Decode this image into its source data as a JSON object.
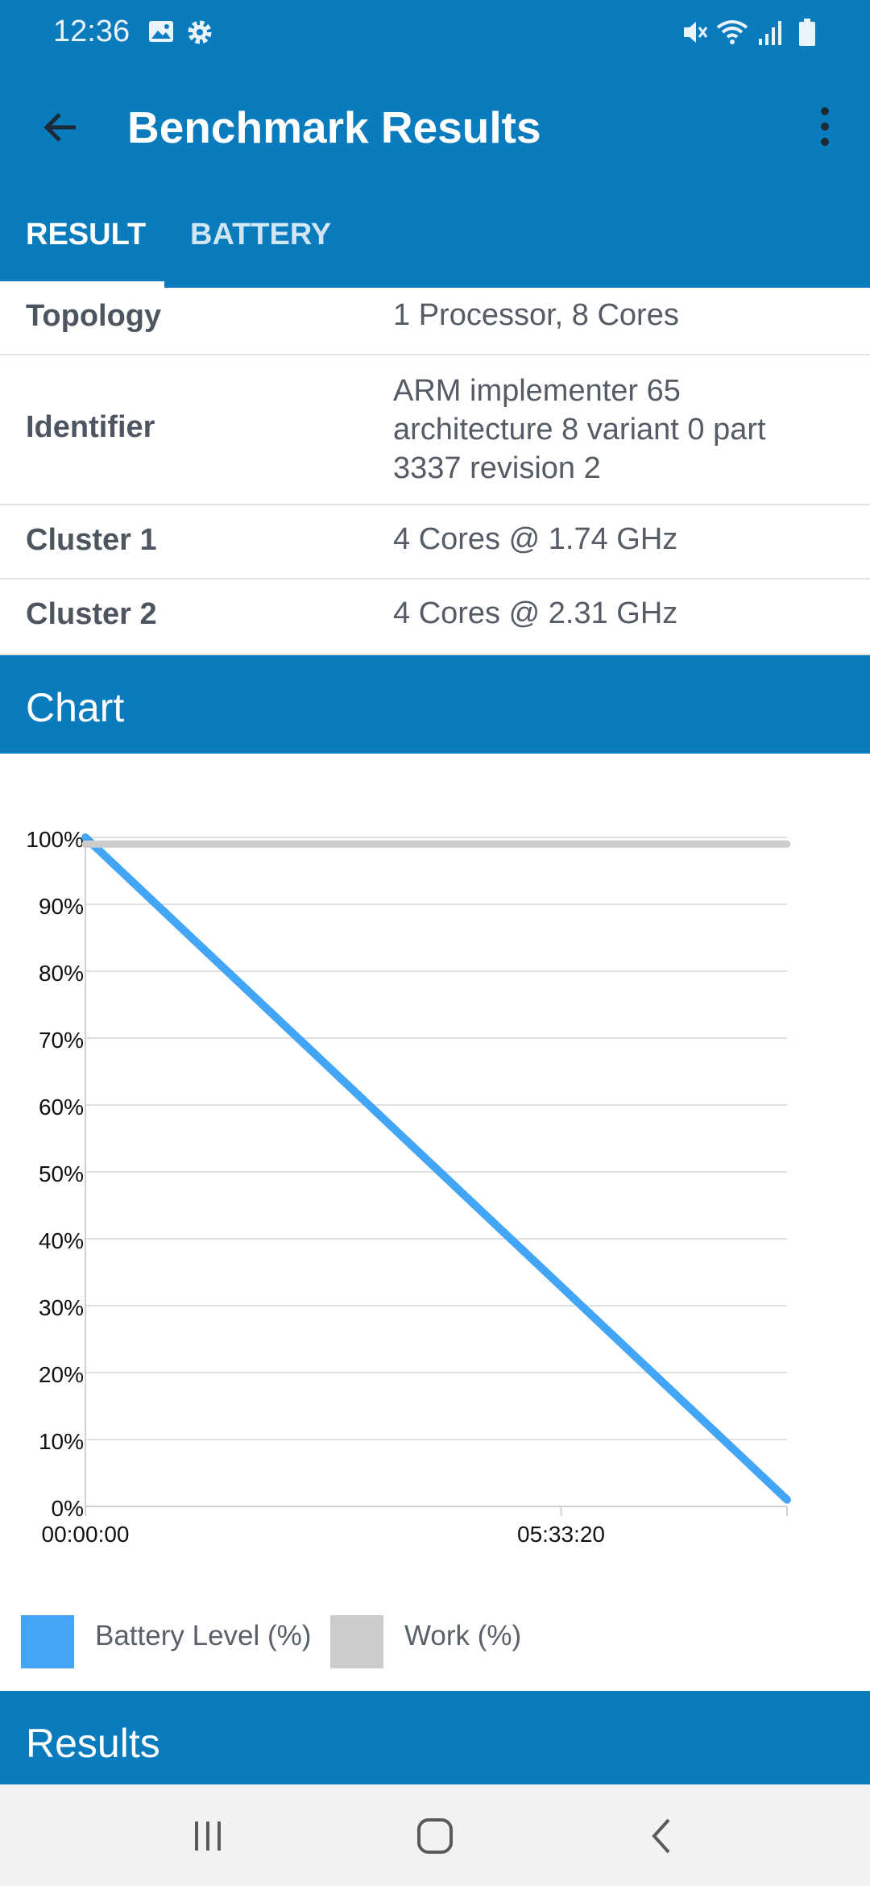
{
  "status_bar": {
    "time": "12:36",
    "icons": [
      "image-icon",
      "settings-gear-icon",
      "mute-icon",
      "wifi-icon",
      "signal-icon",
      "battery-icon"
    ]
  },
  "toolbar": {
    "title": "Benchmark Results",
    "back_icon": "arrow-back-icon",
    "more_icon": "more-vert-icon"
  },
  "tabs": [
    {
      "label": "RESULT",
      "active": true
    },
    {
      "label": "BATTERY",
      "active": false
    }
  ],
  "info_rows": [
    {
      "key": "Topology",
      "value": "1 Processor, 8 Cores"
    },
    {
      "key": "Identifier",
      "value_lines": [
        "ARM implementer 65",
        "architecture 8 variant 0 part",
        "3337 revision 2"
      ]
    },
    {
      "key": "Cluster 1",
      "value": "4 Cores @ 1.74 GHz"
    },
    {
      "key": "Cluster 2",
      "value": "4 Cores @ 2.31 GHz"
    }
  ],
  "sections": {
    "chart": "Chart",
    "results": "Results"
  },
  "chart_data": {
    "type": "line",
    "title": "",
    "xlabel": "",
    "ylabel": "",
    "y_ticks": [
      "100%",
      "90%",
      "80%",
      "70%",
      "60%",
      "50%",
      "40%",
      "30%",
      "20%",
      "10%",
      "0%"
    ],
    "ylim": [
      0,
      100
    ],
    "x_tick_labels": [
      "00:00:00",
      "05:33:20"
    ],
    "x_seconds_at_tick_labels": [
      0,
      20000
    ],
    "xlim_seconds": [
      0,
      29500
    ],
    "grid": true,
    "legend_position": "bottom",
    "series": [
      {
        "name": "Battery Level (%)",
        "color": "#42a5f5",
        "x_seconds": [
          0,
          29500
        ],
        "values": [
          100,
          1
        ]
      },
      {
        "name": "Work (%)",
        "color": "#cccccc",
        "x_seconds": [
          0,
          29500
        ],
        "values": [
          99,
          99
        ]
      }
    ]
  },
  "nav_bar": {
    "icons": [
      "recent-apps-icon",
      "home-icon",
      "back-nav-icon"
    ]
  }
}
